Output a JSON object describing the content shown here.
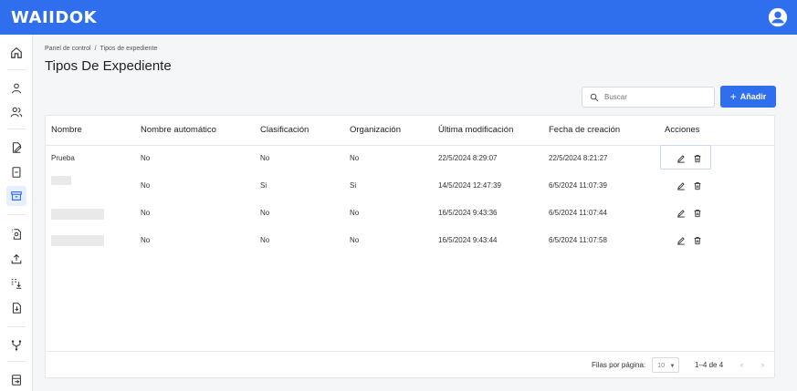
{
  "app": {
    "logo": "WAIIDOK"
  },
  "breadcrumb": {
    "home": "Panel de control",
    "separator": "/",
    "current": "Tipos de expediente"
  },
  "page": {
    "title": "Tipos De Expediente"
  },
  "search": {
    "placeholder": "Buscar"
  },
  "toolbar": {
    "add_icon": "+",
    "add_label": "Añadir"
  },
  "sidebar": {
    "icons": [
      "home-icon",
      "user-icon",
      "users-icon",
      "document-signature-icon",
      "file-icon",
      "archive-icon",
      "file-search-icon",
      "upload-icon",
      "list-download-icon",
      "file-export-icon",
      "workflow-icon",
      "logout-icon"
    ]
  },
  "table": {
    "columns": [
      "Nombre",
      "Nombre automático",
      "Clasificación",
      "Organización",
      "Última modificación",
      "Fecha de creación",
      "Acciones"
    ],
    "rows": [
      {
        "nombre": "Prueba",
        "automatico": "No",
        "clasificacion": "No",
        "organizacion": "No",
        "modificacion": "22/5/2024 8:29:07",
        "creacion": "22/5/2024 8:21:27"
      },
      {
        "nombre": "",
        "automatico": "No",
        "clasificacion": "Si",
        "organizacion": "Si",
        "modificacion": "14/5/2024 12:47:39",
        "creacion": "6/5/2024 11:07:39"
      },
      {
        "nombre": "",
        "automatico": "No",
        "clasificacion": "No",
        "organizacion": "No",
        "modificacion": "16/5/2024 9:43:36",
        "creacion": "6/5/2024 11:07:44"
      },
      {
        "nombre": "",
        "automatico": "No",
        "clasificacion": "No",
        "organizacion": "No",
        "modificacion": "16/5/2024 9:43:44",
        "creacion": "6/5/2024 11:07:58"
      }
    ]
  },
  "pagination": {
    "rows_per_page_label": "Filas por página:",
    "rows_per_page": "10",
    "range": "1–4 de 4",
    "prev": "‹",
    "next": "›"
  },
  "colors": {
    "primary": "#2f6fee"
  }
}
